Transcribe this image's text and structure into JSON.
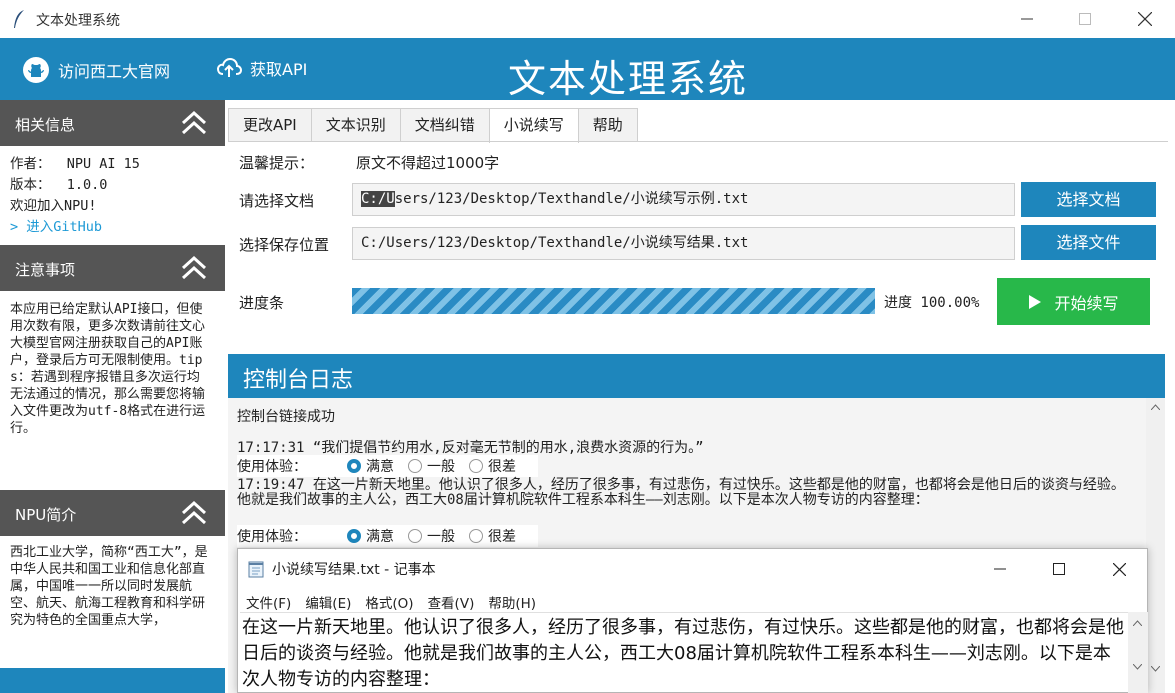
{
  "window": {
    "title": "文本处理系统"
  },
  "header": {
    "github_link": "访问西工大官网",
    "api_link": "获取API",
    "title": "文本处理系统"
  },
  "sidebar": {
    "info": {
      "heading": "相关信息",
      "author": "作者：  NPU AI 15",
      "version": "版本：  1.0.0",
      "welcome": "欢迎加入NPU!",
      "github": "> 进入GitHub"
    },
    "notice": {
      "heading": "注意事项",
      "text": "本应用已给定默认API接口，但使用次数有限，更多次数请前往文心大模型官网注册获取自己的API账户，登录后方可无限制使用。tips：若遇到程序报错且多次运行均无法通过的情况，那么需要您将输入文件更改为utf-8格式在进行运行。"
    },
    "npu": {
      "heading": "NPU简介",
      "text": "西北工业大学，简称“西工大”，是中华人民共和国工业和信息化部直属，中国唯一一所以同时发展航空、航天、航海工程教育和科学研究为特色的全国重点大学，"
    }
  },
  "tabs": [
    {
      "label": "更改API",
      "active": false
    },
    {
      "label": "文本识别",
      "active": false
    },
    {
      "label": "文档纠错",
      "active": false
    },
    {
      "label": "小说续写",
      "active": true
    },
    {
      "label": "帮助",
      "active": false
    }
  ],
  "panel": {
    "tip_label": "温馨提示：",
    "tip_text": "原文不得超过1000字",
    "doc_label": "请选择文档",
    "doc_path_selected": "C:/U",
    "doc_path_rest": "sers/123/Desktop/Texthandle/小说续写示例.txt",
    "doc_button": "选择文档",
    "save_label": "选择保存位置",
    "save_path": "C:/Users/123/Desktop/Texthandle/小说续写结果.txt",
    "save_button": "选择文件",
    "progress_label": "进度条",
    "progress_text": "进度 100.00%",
    "progress_value": 100,
    "start_button": "开始续写"
  },
  "console": {
    "heading": "控制台日志",
    "connected": "控制台链接成功",
    "entry1": "17:17:31 “我们提倡节约用水,反对毫无节制的用水,浪费水资源的行为。”",
    "entry2": "17:19:47 在这一片新天地里。他认识了很多人，经历了很多事，有过悲伤，有过快乐。这些都是他的财富，也都将会是他日后的谈资与经验。他就是我们故事的主人公，西工大08届计算机院软件工程系本科生——刘志刚。以下是本次人物专访的内容整理：",
    "rating_label": "使用体验：",
    "options": [
      "满意",
      "一般",
      "很差"
    ],
    "selected": "满意"
  },
  "notepad": {
    "title": "小说续写结果.txt - 记事本",
    "menu": [
      "文件(F)",
      "编辑(E)",
      "格式(O)",
      "查看(V)",
      "帮助(H)"
    ],
    "content": "在这一片新天地里。他认识了很多人，经历了很多事，有过悲伤，有过快乐。这些都是他的财富，也都将会是他日后的谈资与经验。他就是我们故事的主人公，西工大08届计算机院软件工程系本科生——刘志刚。以下是本次人物专访的内容整理："
  },
  "colors": {
    "accent": "#1e86bc",
    "sidebar_head": "#555555",
    "start": "#28b84a"
  }
}
